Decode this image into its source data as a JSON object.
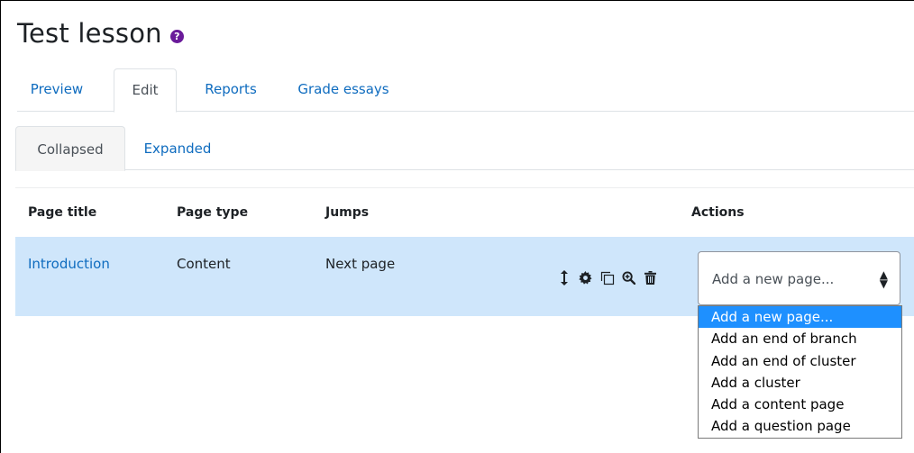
{
  "page": {
    "title": "Test lesson",
    "help_icon": "question-circle-icon"
  },
  "tabs": [
    {
      "label": "Preview",
      "active": false
    },
    {
      "label": "Edit",
      "active": true
    },
    {
      "label": "Reports",
      "active": false
    },
    {
      "label": "Grade essays",
      "active": false
    }
  ],
  "subtabs": [
    {
      "label": "Collapsed",
      "active": true
    },
    {
      "label": "Expanded",
      "active": false
    }
  ],
  "table": {
    "headers": [
      "Page title",
      "Page type",
      "Jumps",
      "Actions"
    ],
    "rows": [
      {
        "title": "Introduction",
        "type": "Content",
        "jumps": "Next page"
      }
    ],
    "action_icons": [
      "move-icon",
      "gear-icon",
      "copy-icon",
      "preview-icon",
      "trash-icon"
    ]
  },
  "add_page_select": {
    "selected": "Add a new page...",
    "options": [
      "Add a new page...",
      "Add an end of branch",
      "Add an end of cluster",
      "Add a cluster",
      "Add a content page",
      "Add a question page"
    ],
    "highlighted_index": 0
  },
  "colors": {
    "link": "#0f6cbf",
    "row_highlight": "#cfe6fb",
    "option_highlight": "#1e90ff",
    "help_icon": "#6a1b9a"
  }
}
